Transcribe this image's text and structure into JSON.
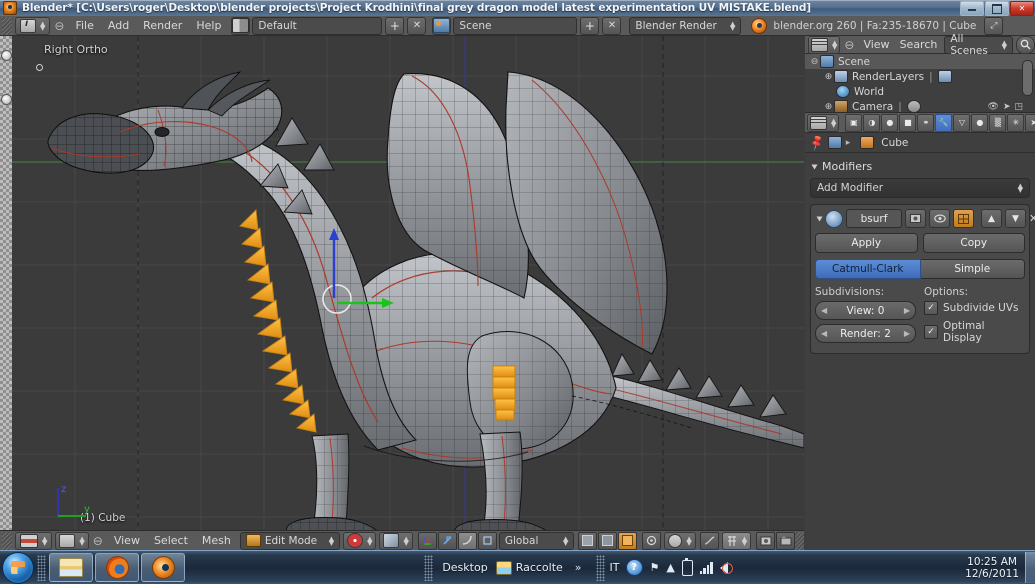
{
  "window": {
    "title": "Blender* [C:\\Users\\roger\\Desktop\\blender projects\\Project Krodhini\\final grey dragon model latest experimentation UV MISTAKE.blend]",
    "app_icon": "blender-icon",
    "minimize": "minimize-icon",
    "maximize": "maximize-icon",
    "close": "close-icon"
  },
  "info_header": {
    "editor_icon": "info-editor-icon",
    "collapse_icon": "collapse-menu-icon",
    "menus": [
      "File",
      "Add",
      "Render",
      "Help"
    ],
    "screen_layout": {
      "icon": "screen-layout-icon",
      "value": "Default",
      "add": "+",
      "remove": "✕"
    },
    "scene": {
      "icon": "scene-icon",
      "value": "Scene",
      "add": "+",
      "remove": "✕"
    },
    "render_engine": "Blender Render",
    "version_status": "blender.org 260 | Fa:235-18670 | Cube",
    "corner_icon": "maximize-area-icon"
  },
  "viewport": {
    "view_label": "Right Ortho",
    "object_label": "(1) Cube",
    "axis_gizmo": {
      "z": "z",
      "y": "y"
    },
    "background": "#3b3b3b",
    "grid_color": "#4a4a4a",
    "axis_y_color": "#3d7a3d",
    "axis_z_color": "#3a3a7e",
    "manipulator": {
      "z_axis_color": "#2b3fd0",
      "y_axis_color": "#1ec41e"
    },
    "mesh": {
      "surface_light": "#b9bcc1",
      "surface_mid": "#85888d",
      "surface_dark": "#5f6368",
      "wire_color": "#151515",
      "seam_color": "#b0372a",
      "selected_color": "#f4a21a"
    }
  },
  "viewport_footer": {
    "editor_icon": "3d-view-editor-icon",
    "collapse_icon": "collapse-menu-icon",
    "menus": [
      "View",
      "Select",
      "Mesh"
    ],
    "mode": {
      "icon": "edit-mode-icon",
      "value": "Edit Mode"
    },
    "viewport_shading": "solid-shading-icon",
    "pivot_icon": "pivot-point-icon",
    "snap_icon": "snap-magnet-icon",
    "manipulator_icons": [
      "translate-manipulator-icon",
      "rotate-manipulator-icon",
      "scale-manipulator-icon"
    ],
    "transform_orientation": "Global",
    "select_modes": [
      "vertex-select-icon",
      "edge-select-icon",
      "face-select-icon"
    ],
    "occlude_icon": "limit-selection-visible-icon",
    "proportional_icon": "proportional-edit-icon",
    "proportional_falloff": "smooth-falloff-icon",
    "snap_during_transform": "snap-element-icon",
    "render_icons": [
      "render-image-icon",
      "render-animation-icon"
    ]
  },
  "outliner": {
    "editor_icon": "outliner-editor-icon",
    "collapse_icon": "collapse-menu-icon",
    "menus": [
      "View",
      "Search"
    ],
    "display_mode": "All Scenes",
    "filter_icon": "search-filter-icon",
    "rows": [
      {
        "label": "Scene",
        "icon": "scene-icon",
        "expander": "⊖",
        "indent": 0,
        "selected": true
      },
      {
        "label": "RenderLayers",
        "icon": "render-layers-icon",
        "expander": "⊕",
        "indent": 1,
        "selected": false
      },
      {
        "label": "World",
        "icon": "world-icon",
        "expander": "",
        "indent": 1,
        "selected": false
      },
      {
        "label": "Camera",
        "icon": "camera-icon",
        "expander": "⊕",
        "indent": 1,
        "selected": false
      }
    ],
    "visibility_icons": [
      "eye-icon",
      "cursor-select-icon",
      "render-visibility-icon"
    ]
  },
  "properties": {
    "editor_icon": "properties-editor-icon",
    "tabs": [
      {
        "name": "render-tab",
        "glyph": "▣",
        "active": false
      },
      {
        "name": "scene-tab",
        "glyph": "◑",
        "active": false
      },
      {
        "name": "world-tab",
        "glyph": "●",
        "active": false
      },
      {
        "name": "object-tab",
        "glyph": "■",
        "active": false
      },
      {
        "name": "constraints-tab",
        "glyph": "⚭",
        "active": false
      },
      {
        "name": "modifiers-tab",
        "glyph": "🔧",
        "active": true
      },
      {
        "name": "object-data-tab",
        "glyph": "▽",
        "active": false
      },
      {
        "name": "material-tab",
        "glyph": "●",
        "active": false
      },
      {
        "name": "texture-tab",
        "glyph": "▒",
        "active": false
      },
      {
        "name": "particles-tab",
        "glyph": "✳",
        "active": false
      },
      {
        "name": "physics-tab",
        "glyph": "➤",
        "active": false
      }
    ],
    "breadcrumb": {
      "pin": "pin-icon",
      "object_icon": "object-icon",
      "arrow": "▸",
      "data_icon": "mesh-data-icon",
      "label": "Cube"
    },
    "panel_title": "Modifiers",
    "add_modifier": "Add Modifier",
    "modifier": {
      "expand_icon": "expand-triangle-icon",
      "type_icon": "subsurf-modifier-icon",
      "name": "bsurf",
      "toggles": [
        {
          "name": "render-toggle-icon",
          "glyph": "▣",
          "on": false
        },
        {
          "name": "realtime-toggle-icon",
          "glyph": "◉",
          "on": false
        },
        {
          "name": "editmode-toggle-icon",
          "glyph": "▦",
          "on": true
        }
      ],
      "move_up": "move-up-icon",
      "move_down": "move-down-icon",
      "delete": "✕",
      "apply": "Apply",
      "copy": "Copy",
      "subdivision_type": [
        {
          "label": "Catmull-Clark",
          "active": true
        },
        {
          "label": "Simple",
          "active": false
        }
      ],
      "subdivisions_label": "Subdivisions:",
      "view": {
        "label": "View:",
        "value": "0"
      },
      "render": {
        "label": "Render:",
        "value": "2"
      },
      "options_label": "Options:",
      "options": [
        {
          "label": "Subdivide UVs",
          "checked": true
        },
        {
          "label": "Optimal Display",
          "checked": true
        }
      ]
    },
    "accent_color": "#3f6cbb"
  },
  "taskbar": {
    "start": "windows-start-orb-icon",
    "pinned": [
      {
        "name": "explorer-taskbar-icon"
      },
      {
        "name": "firefox-taskbar-icon"
      },
      {
        "name": "blender-taskbar-icon"
      }
    ],
    "toolbar_label": "Desktop",
    "library_icon": "library-icon",
    "library_label": "Raccolte",
    "overflow": "»",
    "language": "IT",
    "tray": [
      "help-icon",
      "action-center-icon",
      "show-hidden-icon",
      "battery-icon",
      "network-icon",
      "volume-muted-icon"
    ],
    "clock_time": "10:25 AM",
    "clock_date": "12/6/2011",
    "show_desktop": "show-desktop-button"
  }
}
